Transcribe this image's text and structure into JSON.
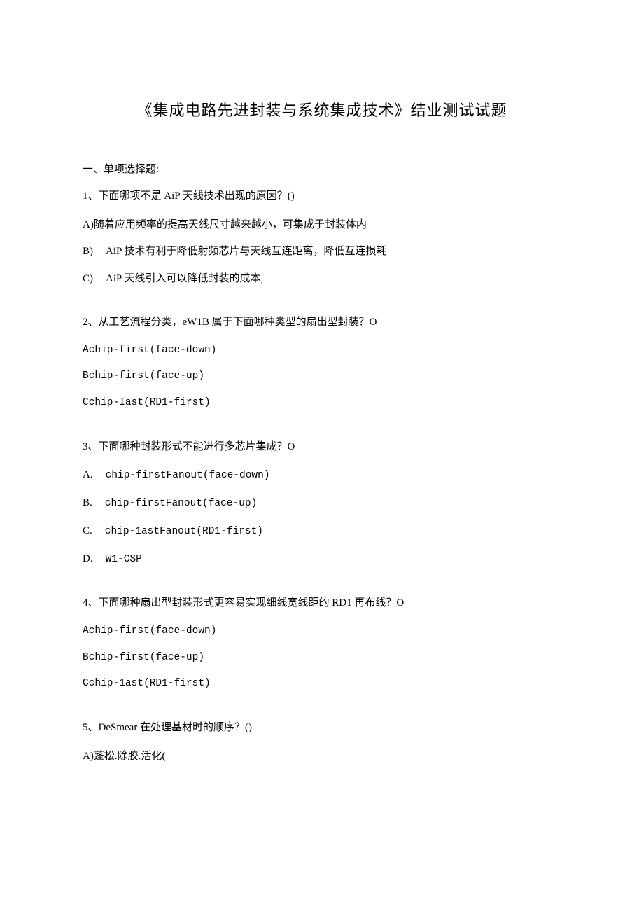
{
  "title": "《集成电路先进封装与系统集成技术》结业测试试题",
  "section1": {
    "header": "一、单项选择题:",
    "q1": {
      "stem": "1、下面哪项不是 AiP 天线技术出现的原因？()",
      "a": "A)随着应用频率的提高天线尺寸越来越小，可集成于封装体内",
      "b_label": "B)",
      "b_text": "AiP 技术有利于降低射频芯片与天线互连距离，降低互连损耗",
      "c_label": "C)",
      "c_text": "AiP 天线引入可以降低封装的成本,"
    },
    "q2": {
      "stem": "2、从工艺流程分类，eW1B 属于下面哪种类型的扇出型封装？O",
      "a": "Achip-first(face-down)",
      "b": "Bchip-first(face-up)",
      "c": "Cchip-Iast(RD1-first)"
    },
    "q3": {
      "stem": "3、下面哪种封装形式不能进行多芯片集成？O",
      "a_label": "A.",
      "a_text": "chip-firstFanout(face-down)",
      "b_label": "B.",
      "b_text": "chip-firstFanout(face-up)",
      "c_label": "C.",
      "c_text": "chip-1astFanout(RD1-first)",
      "d_label": "D.",
      "d_text": "W1-CSP"
    },
    "q4": {
      "stem": "4、下面哪种扇出型封装形式更容易实现细线宽线距的 RD1 再布线？O",
      "a": "Achip-first(face-down)",
      "b": "Bchip-first(face-up)",
      "c": "Cchip-1ast(RD1-first)"
    },
    "q5": {
      "stem": "5、DeSmear 在处理基材时的顺序？()",
      "a": "A)蓬松.除胶.活化("
    }
  }
}
